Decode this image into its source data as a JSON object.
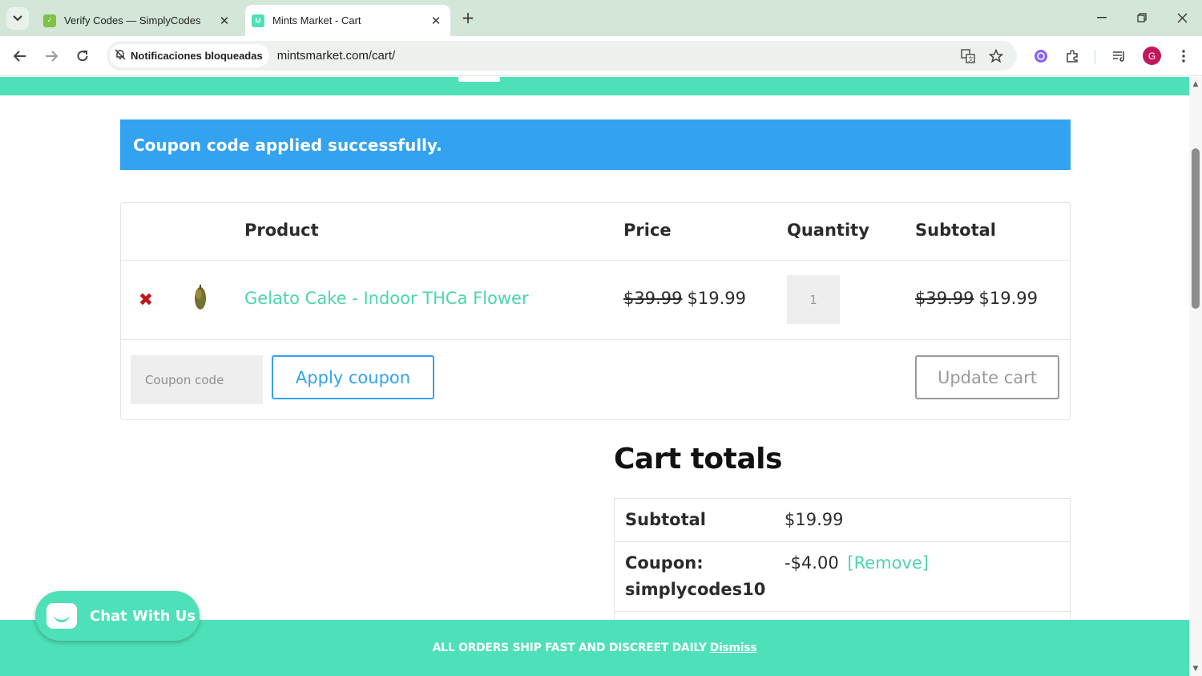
{
  "browser": {
    "tabs": [
      {
        "title": "Verify Codes — SimplyCodes",
        "favicon": "simplycodes-favicon",
        "active": false
      },
      {
        "title": "Mints Market - Cart",
        "favicon": "mints-favicon",
        "active": true
      }
    ],
    "omnibox": {
      "chip_label": "Notificaciones bloqueadas",
      "url": "mintsmarket.com/cart/"
    },
    "profile_initial": "G"
  },
  "page": {
    "notice": "Coupon code applied successfully.",
    "cart_table": {
      "headers": {
        "product": "Product",
        "price": "Price",
        "quantity": "Quantity",
        "subtotal": "Subtotal"
      },
      "items": [
        {
          "name": "Gelato Cake - Indoor THCa Flower",
          "price_old": "$39.99",
          "price_new": "$19.99",
          "quantity": "1",
          "subtotal_old": "$39.99",
          "subtotal_new": "$19.99"
        }
      ],
      "coupon_placeholder": "Coupon code",
      "apply_label": "Apply coupon",
      "update_label": "Update cart"
    },
    "totals": {
      "title": "Cart totals",
      "subtotal_label": "Subtotal",
      "subtotal_value": "$19.99",
      "coupon_label_line1": "Coupon:",
      "coupon_label_line2": "simplycodes10",
      "coupon_value": "-$4.00",
      "coupon_remove": "[Remove]"
    },
    "store_notice": {
      "text": "ALL ORDERS SHIP FAST AND DISCREET DAILY",
      "dismiss": "Dismiss"
    },
    "chat": {
      "label": "Chat With Us"
    }
  },
  "colors": {
    "brand_mint": "#4ee0b8",
    "info_blue": "#33a2f0",
    "remove_red": "#c0171a",
    "link_green": "#4bd6ac"
  }
}
